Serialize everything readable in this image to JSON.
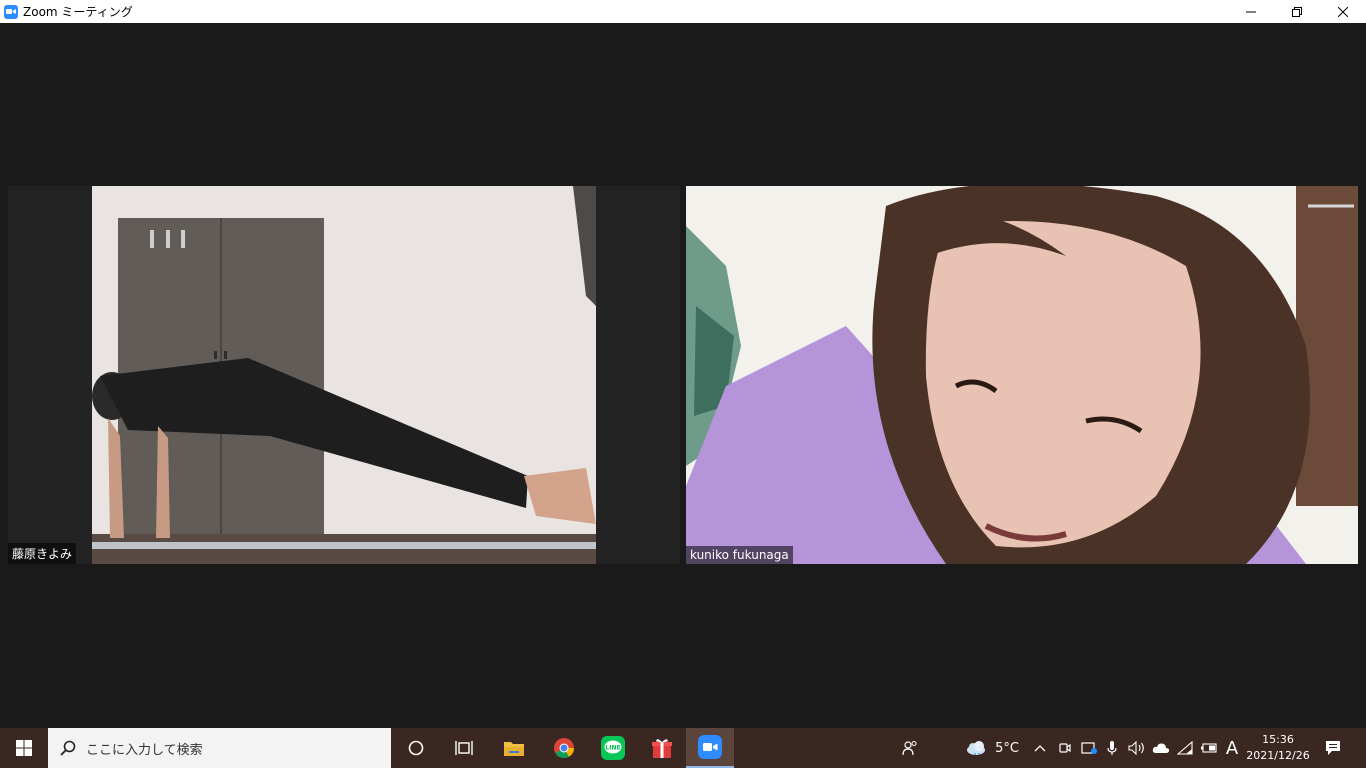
{
  "window": {
    "title": "Zoom ミーティング",
    "icon": "zoom-camera-icon"
  },
  "participants": [
    {
      "name": "藤原きよみ",
      "scene": "person doing plank on floor mat, wall and wardrobe behind"
    },
    {
      "name": "kuniko fukunaga",
      "scene": "close-up of woman in lavender shirt leaning toward camera"
    }
  ],
  "taskbar": {
    "search_placeholder": "ここに入力して検索",
    "pinned": [
      "cortana-icon",
      "task-view-icon",
      "file-explorer-icon",
      "chrome-icon",
      "line-icon",
      "gift-icon",
      "zoom-icon"
    ],
    "active_app": "zoom-icon"
  },
  "tray": {
    "weather_temp": "5°C",
    "ime_label": "A",
    "time": "15:36",
    "date": "2021/12/26"
  },
  "colors": {
    "meeting_bg": "#1a1a1a",
    "taskbar_bg": "#3b2721",
    "zoom_blue": "#2d8cff",
    "line_green": "#06c755"
  }
}
